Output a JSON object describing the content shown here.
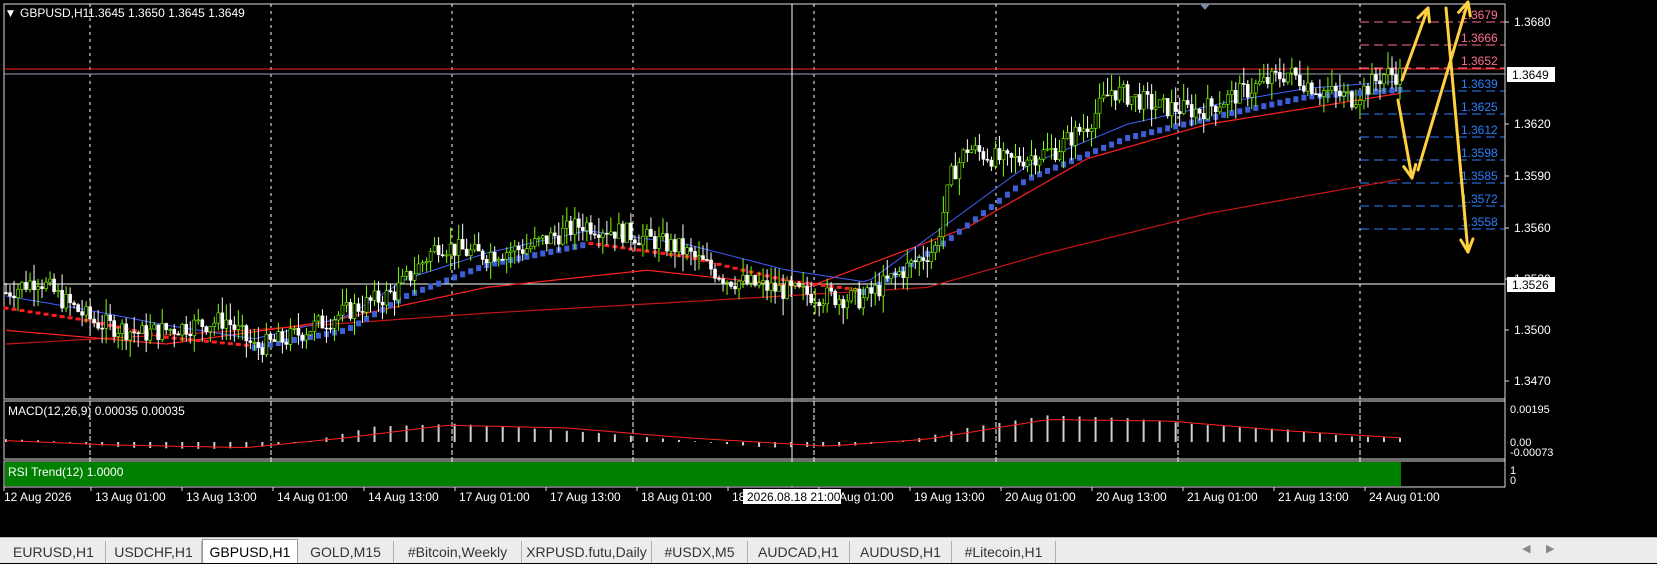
{
  "window": {
    "symbol_header": "GBPUSD,H1",
    "ohlc_header": "1.3645 1.3650 1.3645 1.3649",
    "menu_icon": "triangle-down-icon"
  },
  "price_axis": {
    "ticks": [
      "1.3680",
      "1.3649",
      "1.3620",
      "1.3590",
      "1.3560",
      "1.3530",
      "1.3526",
      "1.3500",
      "1.3470"
    ],
    "current_price": "1.3649",
    "crosshair_price": "1.3526"
  },
  "levels": {
    "upper": [
      "1.3679",
      "1.3666",
      "1.3652"
    ],
    "lower": [
      "1.3639",
      "1.3625",
      "1.3612",
      "1.3598",
      "1.3585",
      "1.3572",
      "1.3558"
    ],
    "upper_color": "#ff7090",
    "lower_color": "#2f7fff"
  },
  "macd": {
    "label": "MACD(12,26,9) 0.00035 0.00035",
    "axis_ticks": [
      "0.00195",
      "0.00",
      "-0.00073"
    ]
  },
  "rsi_trend": {
    "label": "RSI Trend(12) 1.0000",
    "axis_ticks": [
      "1",
      "0"
    ],
    "bar_color": "#008000"
  },
  "time_axis": {
    "labels": [
      "12 Aug 2026",
      "13 Aug 01:00",
      "13 Aug 13:00",
      "14 Aug 01:00",
      "14 Aug 13:00",
      "17 Aug 01:00",
      "17 Aug 13:00",
      "18 Aug 01:00",
      "18 Aug 13:00",
      "19 Aug 01:00",
      "19 Aug 13:00",
      "20 Aug 01:00",
      "20 Aug 13:00",
      "21 Aug 01:00",
      "21 Aug 13:00",
      "24 Aug 01:00"
    ],
    "crosshair_time": "2026.08.18 21:00"
  },
  "tabs": [
    {
      "label": "EURUSD,H1",
      "active": false
    },
    {
      "label": "USDCHF,H1",
      "active": false
    },
    {
      "label": "GBPUSD,H1",
      "active": true
    },
    {
      "label": "GOLD,M15",
      "active": false
    },
    {
      "label": "#Bitcoin,Weekly",
      "active": false
    },
    {
      "label": "XRPUSD.futu,Daily",
      "active": false
    },
    {
      "label": "#USDX,M5",
      "active": false
    },
    {
      "label": "AUDCAD,H1",
      "active": false
    },
    {
      "label": "AUDUSD,H1",
      "active": false
    },
    {
      "label": "#Litecoin,H1",
      "active": false
    }
  ],
  "tab_scroll": {
    "left_icon": "scroll-left-icon",
    "right_icon": "scroll-right-icon"
  },
  "colors": {
    "background": "#000000",
    "bull_candle": "#7fff00",
    "bear_candle": "#ffffff",
    "ema_fast": "#4060ff",
    "ma_slow": "#ff2020",
    "ma_long": "#c81414",
    "trend_up": "#3c5fd8",
    "trend_down": "#ff1e1e",
    "arrow": "#ffd040",
    "grid": "#ffffff"
  },
  "chart_data": {
    "type": "candlestick",
    "timeframe": "H1",
    "ylim": [
      1.346,
      1.369
    ],
    "close_path": [
      [
        0,
        1.3522
      ],
      [
        8,
        1.353
      ],
      [
        14,
        1.3518
      ],
      [
        22,
        1.3505
      ],
      [
        34,
        1.3498
      ],
      [
        44,
        1.3502
      ],
      [
        55,
        1.3506
      ],
      [
        62,
        1.349
      ],
      [
        70,
        1.3495
      ],
      [
        84,
        1.351
      ],
      [
        97,
        1.3522
      ],
      [
        108,
        1.355
      ],
      [
        118,
        1.3544
      ],
      [
        130,
        1.3548
      ],
      [
        144,
        1.3562
      ],
      [
        156,
        1.3556
      ],
      [
        168,
        1.3548
      ],
      [
        180,
        1.353
      ],
      [
        192,
        1.3524
      ],
      [
        204,
        1.352
      ],
      [
        214,
        1.3518
      ],
      [
        224,
        1.3535
      ],
      [
        232,
        1.3548
      ],
      [
        236,
        1.359
      ],
      [
        240,
        1.3606
      ],
      [
        250,
        1.3598
      ],
      [
        262,
        1.3605
      ],
      [
        270,
        1.362
      ],
      [
        276,
        1.364
      ],
      [
        288,
        1.363
      ],
      [
        298,
        1.3628
      ],
      [
        310,
        1.364
      ],
      [
        320,
        1.365
      ],
      [
        328,
        1.364
      ],
      [
        336,
        1.3635
      ],
      [
        344,
        1.3649
      ],
      [
        348,
        1.3649
      ]
    ],
    "fast_ma_path": [
      [
        0,
        1.352
      ],
      [
        20,
        1.3512
      ],
      [
        40,
        1.3503
      ],
      [
        62,
        1.3495
      ],
      [
        85,
        1.3508
      ],
      [
        100,
        1.353
      ],
      [
        120,
        1.3545
      ],
      [
        145,
        1.3558
      ],
      [
        170,
        1.355
      ],
      [
        195,
        1.3535
      ],
      [
        215,
        1.3528
      ],
      [
        235,
        1.3562
      ],
      [
        255,
        1.3596
      ],
      [
        280,
        1.362
      ],
      [
        305,
        1.3633
      ],
      [
        325,
        1.3641
      ],
      [
        348,
        1.3645
      ]
    ],
    "trend_line_path": [
      [
        0,
        1.3512
      ],
      [
        20,
        1.3505
      ],
      [
        40,
        1.3495
      ],
      [
        62,
        1.349
      ],
      [
        85,
        1.35
      ],
      [
        100,
        1.352
      ],
      [
        120,
        1.3538
      ],
      [
        145,
        1.355
      ],
      [
        170,
        1.3542
      ],
      [
        195,
        1.3528
      ],
      [
        215,
        1.3522
      ],
      [
        235,
        1.3552
      ],
      [
        255,
        1.3588
      ],
      [
        280,
        1.3612
      ],
      [
        305,
        1.3626
      ],
      [
        325,
        1.3636
      ],
      [
        348,
        1.364
      ]
    ],
    "slow_ma_path": [
      [
        0,
        1.35
      ],
      [
        40,
        1.3492
      ],
      [
        80,
        1.3505
      ],
      [
        120,
        1.3525
      ],
      [
        160,
        1.3535
      ],
      [
        200,
        1.3525
      ],
      [
        240,
        1.356
      ],
      [
        270,
        1.36
      ],
      [
        300,
        1.362
      ],
      [
        348,
        1.3638
      ]
    ],
    "long_ma_path": [
      [
        0,
        1.3492
      ],
      [
        60,
        1.35
      ],
      [
        120,
        1.351
      ],
      [
        180,
        1.3518
      ],
      [
        230,
        1.3525
      ],
      [
        260,
        1.3545
      ],
      [
        300,
        1.3568
      ],
      [
        348,
        1.3588
      ]
    ],
    "macd_hist_path": [
      [
        0,
        0.0002
      ],
      [
        10,
        0.0001
      ],
      [
        30,
        -0.0004
      ],
      [
        50,
        -0.0005
      ],
      [
        62,
        -0.0004
      ],
      [
        75,
        0.0
      ],
      [
        92,
        0.0011
      ],
      [
        112,
        0.0013
      ],
      [
        130,
        0.001
      ],
      [
        150,
        0.0006
      ],
      [
        170,
        0.0001
      ],
      [
        190,
        -0.0004
      ],
      [
        210,
        -0.0003
      ],
      [
        225,
        0.0001
      ],
      [
        240,
        0.001
      ],
      [
        260,
        0.0019
      ],
      [
        280,
        0.0017
      ],
      [
        300,
        0.0012
      ],
      [
        320,
        0.0009
      ],
      [
        335,
        0.0004
      ],
      [
        348,
        0.0003
      ]
    ],
    "macd_signal_path": [
      [
        0,
        0.0001
      ],
      [
        25,
        -0.0002
      ],
      [
        60,
        -0.0004
      ],
      [
        85,
        0.0003
      ],
      [
        110,
        0.0012
      ],
      [
        140,
        0.001
      ],
      [
        170,
        0.0003
      ],
      [
        205,
        -0.0003
      ],
      [
        230,
        0.0002
      ],
      [
        260,
        0.0016
      ],
      [
        290,
        0.0015
      ],
      [
        320,
        0.0008
      ],
      [
        348,
        0.0003
      ]
    ]
  }
}
